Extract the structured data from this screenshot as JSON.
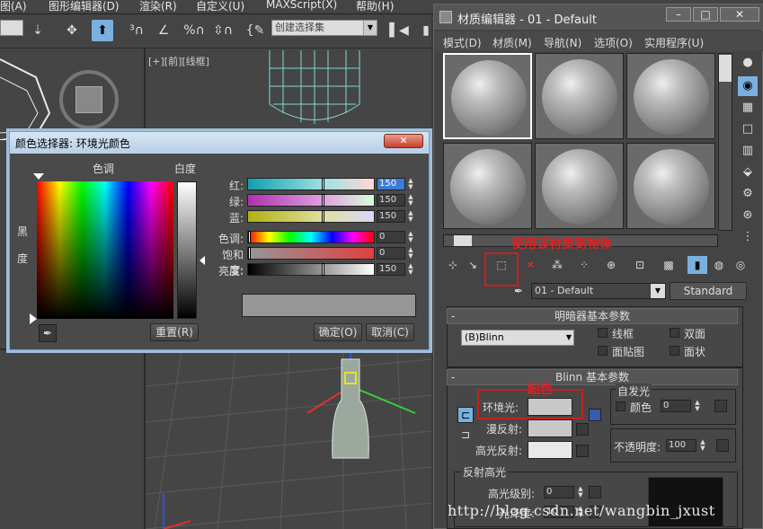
{
  "menubar": {
    "items": [
      "图(A)",
      "图形编辑器(D)",
      "渲染(R)",
      "自定义(U)",
      "MAXScript(X)",
      "帮助(H)"
    ]
  },
  "toolbar": {
    "selection_set": "创建选择集"
  },
  "viewport": {
    "label": "[+][前][线框]"
  },
  "color_picker": {
    "title": "颜色选择器: 环境光颜色",
    "hue_label": "色调",
    "whiteness_label": "白度",
    "blackness_label": "黑度",
    "channels": [
      {
        "label": "红:",
        "value": "150"
      },
      {
        "label": "绿:",
        "value": "150"
      },
      {
        "label": "蓝:",
        "value": "150"
      },
      {
        "label": "色调:",
        "value": "0"
      },
      {
        "label": "饱和度:",
        "value": "0"
      },
      {
        "label": "亮度:",
        "value": "150"
      }
    ],
    "reset_button": "重置(R)",
    "ok_button": "确定(O)",
    "cancel_button": "取消(C)",
    "preview_color": "#969696"
  },
  "material_editor": {
    "title": "材质编辑器 - 01 - Default",
    "menu": [
      "模式(D)",
      "材质(M)",
      "导航(N)",
      "选项(O)",
      "实用程序(U)"
    ],
    "annotation_apply": "使用该材质到物体",
    "material_name": "01 - Default",
    "material_type": "Standard",
    "shader_rollout": "明暗器基本参数",
    "shader_type": "(B)Blinn",
    "wire_label": "线框",
    "two_sided_label": "双面",
    "face_map_label": "面贴图",
    "faceted_label": "面状",
    "blinn_rollout": "Blinn 基本参数",
    "annotation_color": "配色",
    "self_illum_label": "自发光",
    "self_illum_color_label": "颜色",
    "self_illum_value": "0",
    "ambient_label": "环境光:",
    "diffuse_label": "漫反射:",
    "specular_label": "高光反射:",
    "opacity_label": "不透明度:",
    "opacity_value": "100",
    "spec_highlights_label": "反射高光",
    "spec_level_label": "高光级别:",
    "spec_level_value": "0",
    "glossiness_label": "光泽度:",
    "glossiness_value": "10"
  },
  "watermark": "http://blog.csdn.net/wangbin_jxust"
}
